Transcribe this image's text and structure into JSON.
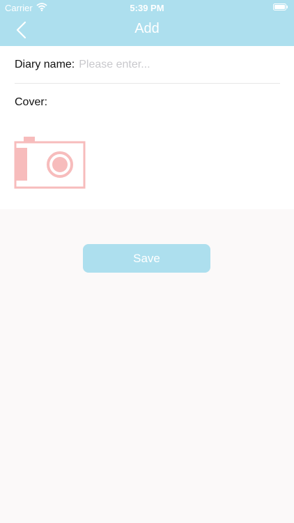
{
  "status_bar": {
    "carrier": "Carrier",
    "time": "5:39 PM",
    "wifi_icon": "wifi-icon",
    "battery_icon": "battery-icon"
  },
  "nav": {
    "title": "Add",
    "back_icon": "chevron-left-icon"
  },
  "form": {
    "name_label": "Diary name:",
    "name_value": "",
    "name_placeholder": "Please enter...",
    "cover_label": "Cover:",
    "cover_icon": "camera-icon"
  },
  "actions": {
    "save_label": "Save"
  },
  "colors": {
    "accent": "#addfee",
    "icon_pink": "#f7bcbc",
    "page_background": "#fbf9f9",
    "form_background": "#ffffff"
  }
}
